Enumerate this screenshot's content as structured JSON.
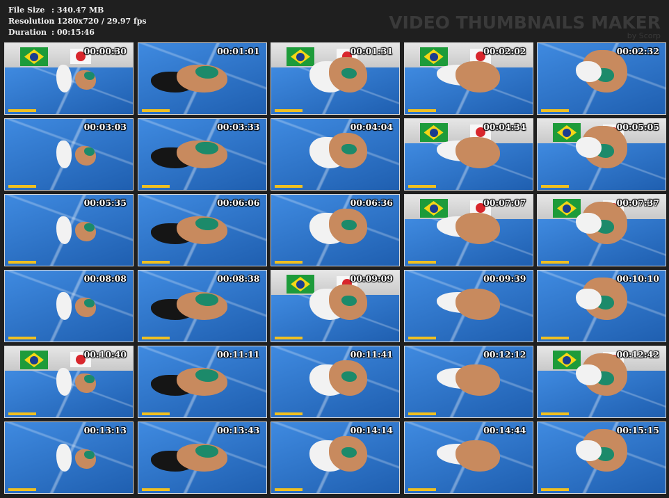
{
  "info": {
    "file_size_label": "File Size",
    "file_size_value": ": 340.47 MB",
    "resolution_label": "Resolution",
    "resolution_value": ": 1280x720 / 29.97 fps",
    "duration_label": "Duration",
    "duration_value": ": 00:15:46"
  },
  "watermark": {
    "title": "VIDEO THUMBNAILS MAKER",
    "by": "by Scorp"
  },
  "thumbnails": [
    {
      "timestamp": "00:00:30",
      "scene": "wall"
    },
    {
      "timestamp": "00:01:01",
      "scene": "mat"
    },
    {
      "timestamp": "00:01:31",
      "scene": "wall"
    },
    {
      "timestamp": "00:02:02",
      "scene": "wall"
    },
    {
      "timestamp": "00:02:32",
      "scene": "mat"
    },
    {
      "timestamp": "00:03:03",
      "scene": "mat"
    },
    {
      "timestamp": "00:03:33",
      "scene": "mat"
    },
    {
      "timestamp": "00:04:04",
      "scene": "mat"
    },
    {
      "timestamp": "00:04:34",
      "scene": "wall"
    },
    {
      "timestamp": "00:05:05",
      "scene": "wall"
    },
    {
      "timestamp": "00:05:35",
      "scene": "mat"
    },
    {
      "timestamp": "00:06:06",
      "scene": "mat"
    },
    {
      "timestamp": "00:06:36",
      "scene": "mat"
    },
    {
      "timestamp": "00:07:07",
      "scene": "wall"
    },
    {
      "timestamp": "00:07:37",
      "scene": "wall"
    },
    {
      "timestamp": "00:08:08",
      "scene": "mat"
    },
    {
      "timestamp": "00:08:38",
      "scene": "mat"
    },
    {
      "timestamp": "00:09:09",
      "scene": "wall"
    },
    {
      "timestamp": "00:09:39",
      "scene": "mat"
    },
    {
      "timestamp": "00:10:10",
      "scene": "mat"
    },
    {
      "timestamp": "00:10:40",
      "scene": "wall"
    },
    {
      "timestamp": "00:11:11",
      "scene": "mat"
    },
    {
      "timestamp": "00:11:41",
      "scene": "mat"
    },
    {
      "timestamp": "00:12:12",
      "scene": "mat"
    },
    {
      "timestamp": "00:12:42",
      "scene": "wall"
    },
    {
      "timestamp": "00:13:13",
      "scene": "mat"
    },
    {
      "timestamp": "00:13:43",
      "scene": "mat"
    },
    {
      "timestamp": "00:14:14",
      "scene": "mat"
    },
    {
      "timestamp": "00:14:44",
      "scene": "mat"
    },
    {
      "timestamp": "00:15:15",
      "scene": "mat"
    }
  ],
  "colors": {
    "background": "#1f1f1f",
    "mat_blue": "#2a6fc0",
    "watermark": "#3a3a3a",
    "text": "#f0f0f0"
  }
}
